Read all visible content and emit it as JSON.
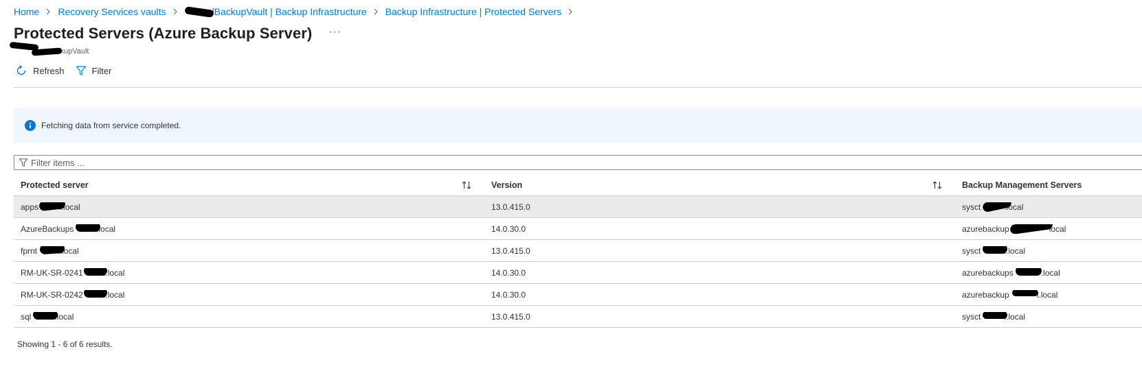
{
  "breadcrumb": {
    "items": [
      {
        "label": "Home"
      },
      {
        "label": "Recovery Services vaults"
      },
      {
        "label": "lBackupVault | Backup Infrastructure"
      },
      {
        "label": "Backup Infrastructure | Protected Servers"
      }
    ]
  },
  "header": {
    "title": "Protected Servers (Azure Backup Server)",
    "more_label": "···",
    "subtitle": "ckupVault"
  },
  "toolbar": {
    "refresh_label": "Refresh",
    "filter_label": "Filter"
  },
  "info_bar": {
    "message": "Fetching data from service completed."
  },
  "filter": {
    "placeholder": "Filter items ..."
  },
  "table": {
    "columns": [
      {
        "label": "Protected server"
      },
      {
        "label": "Version"
      },
      {
        "label": "Backup Management Servers"
      }
    ],
    "rows": [
      {
        "server_a": "apps",
        "server_b": "l.local",
        "version": "13.0.415.0",
        "mgmt_a": "sysct",
        "mgmt_b": ".local"
      },
      {
        "server_a": "AzureBackups",
        "server_b": "l.local",
        "version": "14.0.30.0",
        "mgmt_a": "azurebackup",
        "mgmt_b": "local"
      },
      {
        "server_a": "fprnt",
        "server_b": "l.local",
        "version": "13.0.415.0",
        "mgmt_a": "sysct",
        "mgmt_b": "l.local"
      },
      {
        "server_a": "RM-UK-SR-0241",
        "server_b": "l.local",
        "version": "14.0.30.0",
        "mgmt_a": "azurebackups",
        "mgmt_b": ".local"
      },
      {
        "server_a": "RM-UK-SR-0242",
        "server_b": "l.local",
        "version": "14.0.30.0",
        "mgmt_a": "azurebackup",
        "mgmt_b": "l.local"
      },
      {
        "server_a": "sql",
        "server_b": ".local",
        "version": "13.0.415.0",
        "mgmt_a": "sysct",
        "mgmt_b": "l.local"
      }
    ]
  },
  "footer": {
    "results_text": "Showing 1 - 6 of 6 results."
  },
  "colors": {
    "link": "#0078d4",
    "info_background": "#f0f6fe",
    "selected_row": "#edebe9"
  },
  "icons": [
    "chevron-right-icon",
    "more-icon",
    "refresh-icon",
    "filter-icon",
    "info-icon",
    "sort-icon"
  ]
}
